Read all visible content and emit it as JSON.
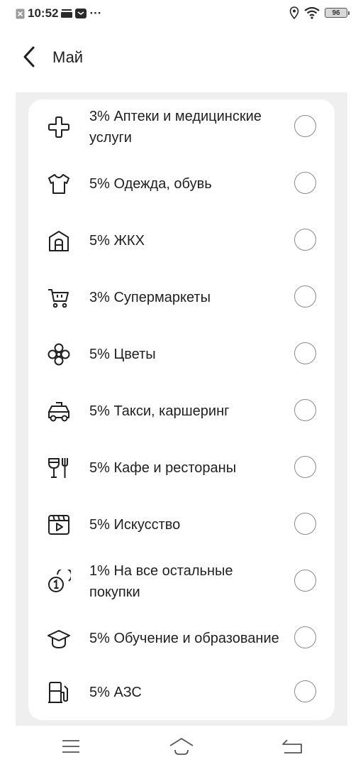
{
  "status_bar": {
    "time": "10:52",
    "more": "···",
    "battery": "96"
  },
  "header": {
    "title": "Май"
  },
  "categories": [
    {
      "label": "3% Аптеки и медицинские услуги",
      "icon": "cross-icon"
    },
    {
      "label": "5% Одежда, обувь",
      "icon": "tshirt-icon"
    },
    {
      "label": "5% ЖКХ",
      "icon": "house-icon"
    },
    {
      "label": "3% Супермаркеты",
      "icon": "cart-icon"
    },
    {
      "label": "5% Цветы",
      "icon": "flower-icon"
    },
    {
      "label": "5% Такси, каршеринг",
      "icon": "taxi-icon"
    },
    {
      "label": "5% Кафе и рестораны",
      "icon": "restaurant-icon"
    },
    {
      "label": "5% Искусство",
      "icon": "film-icon"
    },
    {
      "label": "1% На все остальные покупки",
      "icon": "coins-icon"
    },
    {
      "label": "5% Обучение и образование",
      "icon": "graduation-cap-icon"
    },
    {
      "label": "5% АЗС",
      "icon": "fuel-pump-icon"
    }
  ],
  "colors": {
    "background": "#efefef",
    "card": "#ffffff",
    "text": "#1f1f1f",
    "radio_border": "#8a8a8a"
  }
}
